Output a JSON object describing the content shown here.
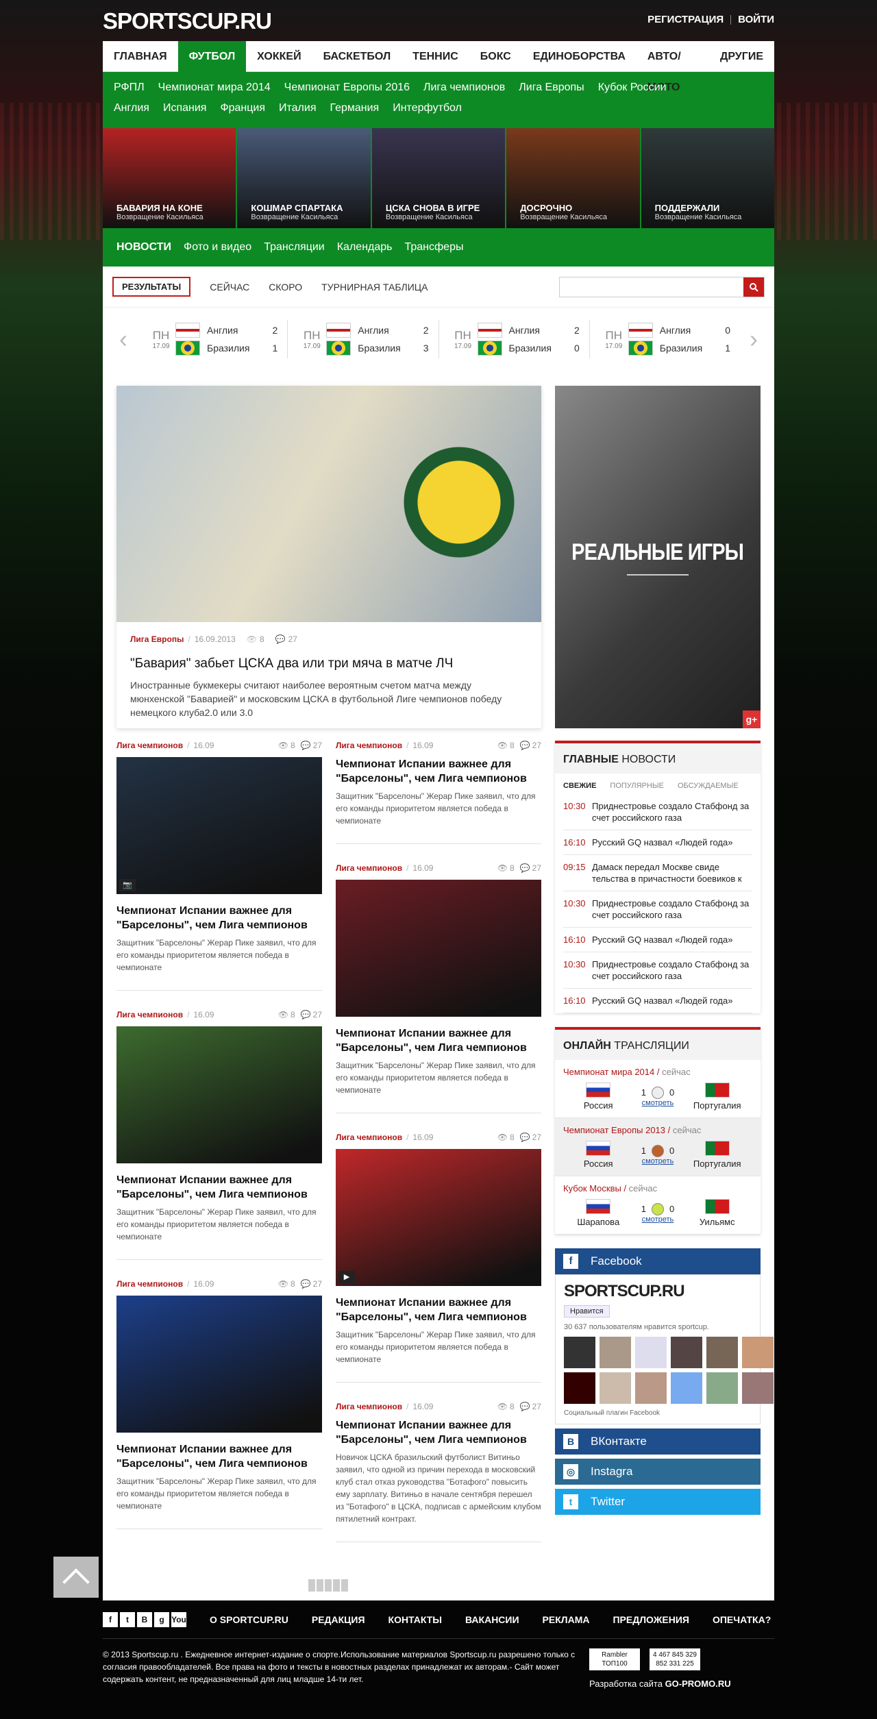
{
  "header": {
    "logo": "SPORTSCUP.RU",
    "register": "РЕГИСТРАЦИЯ",
    "login": "ВОЙТИ"
  },
  "main_nav": [
    "ГЛАВНАЯ",
    "ФУТБОЛ",
    "ХОККЕЙ",
    "БАСКЕТБОЛ",
    "ТЕННИС",
    "БОКС",
    "ЕДИНОБОРСТВА",
    "АВТО/МОТО",
    "ДРУГИЕ"
  ],
  "sub_nav_row1": [
    "РФПЛ",
    "Чемпионат мира 2014",
    "Чемпионат Европы 2016",
    "Лига чемпионов",
    "Лига Европы",
    "Кубок России"
  ],
  "sub_nav_row2": [
    "Англия",
    "Испания",
    "Франция",
    "Италия",
    "Германия",
    "Интерфутбол"
  ],
  "thumbs": [
    {
      "title": "БАВАРИЯ НА КОНЕ",
      "sub": "Возвращение Касильяса",
      "color": "#b52323"
    },
    {
      "title": "КОШМАР СПАРТАКА",
      "sub": "Возвращение Касильяса",
      "color": "#4a5b7a"
    },
    {
      "title": "ЦСКА СНОВА В ИГРЕ",
      "sub": "Возвращение Касильяса",
      "color": "#3a3550"
    },
    {
      "title": "ДОСРОЧНО",
      "sub": "Возвращение Касильяса",
      "color": "#7a3a1c"
    },
    {
      "title": "ПОДДЕРЖАЛИ",
      "sub": "Возвращение Касильяса",
      "color": "#2f3a3a"
    }
  ],
  "sec_nav": [
    "НОВОСТИ",
    "Фото и видео",
    "Трансляции",
    "Календарь",
    "Трансферы"
  ],
  "results_tabs": {
    "active": "РЕЗУЛЬТАТЫ",
    "tabs": [
      "СЕЙЧАС",
      "СКОРО",
      "ТУРНИРНАЯ ТАБЛИЦА"
    ]
  },
  "matches": [
    {
      "day": "ПН",
      "date": "17.09",
      "t1": "Англия",
      "s1": "2",
      "t2": "Бразилия",
      "s2": "1"
    },
    {
      "day": "ПН",
      "date": "17.09",
      "t1": "Англия",
      "s1": "2",
      "t2": "Бразилия",
      "s2": "3"
    },
    {
      "day": "ПН",
      "date": "17.09",
      "t1": "Англия",
      "s1": "2",
      "t2": "Бразилия",
      "s2": "0"
    },
    {
      "day": "ПН",
      "date": "17.09",
      "t1": "Англия",
      "s1": "0",
      "t2": "Бразилия",
      "s2": "1"
    }
  ],
  "lead": {
    "cat": "Лига Европы",
    "date": "16.09.2013",
    "views": "8",
    "comments": "27",
    "title": "\"Бавария\" забьет ЦСКА два или три мяча в матче ЛЧ",
    "text": "Иностранные букмекеры считают наиболее вероятным счетом матча между мюнхенской \"Баварией\" и московским ЦСКА в футбольной Лиге чемпионов победу немецкого клуба2.0 или 3.0"
  },
  "promo": {
    "title": "РЕАЛЬНЫЕ ИГРЫ",
    "gplus": "g+"
  },
  "col_left": [
    {
      "cat": "Лига чемпионов",
      "date": "16.09",
      "views": "8",
      "comments": "27",
      "title": "Чемпионат Испании важнее для \"Барселоны\", чем Лига чемпионов",
      "text": "Защитник \"Барселоны\" Жерар Пике заявил, что для его команды приоритетом является победа в чемпионате",
      "color": "#233244",
      "cam": "📷"
    },
    {
      "cat": "Лига чемпионов",
      "date": "16.09",
      "views": "8",
      "comments": "27",
      "title": "Чемпионат Испании важнее для \"Барселоны\", чем Лига чемпионов",
      "text": "Защитник \"Барселоны\" Жерар Пике заявил, что для его команды приоритетом является победа в чемпионате",
      "color": "#3d6b2f",
      "cam": ""
    },
    {
      "cat": "Лига чемпионов",
      "date": "16.09",
      "views": "8",
      "comments": "27",
      "title": "Чемпионат Испании важнее для \"Барселоны\", чем Лига чемпионов",
      "text": "Защитник \"Барселоны\" Жерар Пике заявил, что для его команды приоритетом является победа в чемпионате",
      "color": "#1d3f8a",
      "cam": ""
    }
  ],
  "col_mid": [
    {
      "cat": "Лига чемпионов",
      "date": "16.09",
      "views": "8",
      "comments": "27",
      "title": "Чемпионат Испании важнее для \"Барселоны\", чем Лига чемпионов",
      "text": "Защитник \"Барселоны\" Жерар Пике заявил, что для его команды приоритетом является победа в чемпионате",
      "color": "",
      "cam": ""
    },
    {
      "cat": "Лига чемпионов",
      "date": "16.09",
      "views": "8",
      "comments": "27",
      "title": "Чемпионат Испании важнее для \"Барселоны\", чем Лига чемпионов",
      "text": "Защитник \"Барселоны\" Жерар Пике заявил, что для его команды приоритетом является победа в чемпионате",
      "color": "#6a1d24",
      "cam": ""
    },
    {
      "cat": "Лига чемпионов",
      "date": "16.09",
      "views": "8",
      "comments": "27",
      "title": "Чемпионат Испании важнее для \"Барселоны\", чем Лига чемпионов",
      "text": "Защитник \"Барселоны\" Жерар Пике заявил, что для его команды приоритетом является победа в чемпионате",
      "color": "#c0282a",
      "cam": "▶"
    },
    {
      "cat": "Лига чемпионов",
      "date": "16.09",
      "views": "8",
      "comments": "27",
      "title": "Чемпионат Испании важнее для \"Барселоны\", чем Лига чемпионов",
      "text": "Новичок ЦСКА бразильский футболист Витиньо заявил, что одной из причин перехода в московский клуб стал отказ руководства \"Ботафого\" повысить ему зарплату. Витиньо в начале сентября перешел из \"Ботафого\" в ЦСКА, подписав с армейским клубом пятилетний контракт.",
      "color": "",
      "cam": ""
    }
  ],
  "main_news": {
    "title_b": "ГЛАВНЫЕ",
    "title": "НОВОСТИ",
    "tabs": [
      "СВЕЖИЕ",
      "ПОПУЛЯРНЫЕ",
      "ОБСУЖДАЕМЫЕ"
    ],
    "items": [
      {
        "time": "10:30",
        "text": "Приднестровье создало Стабфонд за счет российского газа"
      },
      {
        "time": "16:10",
        "text": "Русский GQ назвал «Людей года»"
      },
      {
        "time": "09:15",
        "text": "Дамаск передал Москве свиде тельства в причастности боевиков к"
      },
      {
        "time": "10:30",
        "text": "Приднестровье создало Стабфонд за счет российского газа"
      },
      {
        "time": "16:10",
        "text": "Русский GQ назвал «Людей года»"
      },
      {
        "time": "10:30",
        "text": "Приднестровье создало Стабфонд за счет российского газа"
      },
      {
        "time": "16:10",
        "text": "Русский GQ назвал «Людей года»"
      }
    ]
  },
  "broadcasts": {
    "title_b": "ОНЛАЙН",
    "title": "ТРАНСЛЯЦИИ",
    "items": [
      {
        "league": "Чемпионат мира 2014",
        "status": "сейчас",
        "t1": "Россия",
        "s1": "1",
        "s2": "0",
        "t2": "Португалия",
        "watch": "смотреть",
        "ball": "#eee"
      },
      {
        "league": "Чемпионат Европы 2013",
        "status": "сейчас",
        "t1": "Россия",
        "s1": "1",
        "s2": "0",
        "t2": "Португалия",
        "watch": "смотреть",
        "ball": "#c0602a"
      },
      {
        "league": "Кубок Москвы",
        "status": "сейчас",
        "t1": "Шарапова",
        "s1": "1",
        "s2": "0",
        "t2": "Уильямс",
        "watch": "смотреть",
        "ball": "#c9e34a"
      }
    ]
  },
  "facebook": {
    "label": "Facebook",
    "brand": "SPORTSCUP.RU",
    "like": "Нравится",
    "count": "30 637 пользователям нравится sportcup.",
    "plugin": "Социальный плагин Facebook"
  },
  "socials": [
    {
      "label": "ВКонтакте",
      "icon": "В",
      "color": "#1e4e8c"
    },
    {
      "label": "Instagra",
      "icon": "◎",
      "color": "#2a6a93"
    },
    {
      "label": "Twitter",
      "icon": "t",
      "color": "#1ca4e6"
    }
  ],
  "footer": {
    "links": [
      "О SPORTCUP.RU",
      "РЕДАКЦИЯ",
      "КОНТАКТЫ",
      "ВАКАНСИИ",
      "РЕКЛАМА",
      "ПРЕДЛОЖЕНИЯ",
      "ОПЕЧАТКА?"
    ],
    "icons": [
      "f",
      "t",
      "В",
      "g",
      "You"
    ],
    "copyright": "© 2013 Sportscup.ru . Ежедневное интернет-издание о спорте.Использование материалов Sportscup.ru разрешено только с согласия правообладателей. Все права на фото и тексты в новостных разделах принадлежат их авторам.- Сайт может содержать контент, не предназначенный для лиц младше 14-ти лет.",
    "badge1": "Rambler ТОП100",
    "badge2": "4 467 845 329 852 331 225",
    "dev": "Разработка сайта",
    "dev_b": "GO-PROMO.RU"
  }
}
